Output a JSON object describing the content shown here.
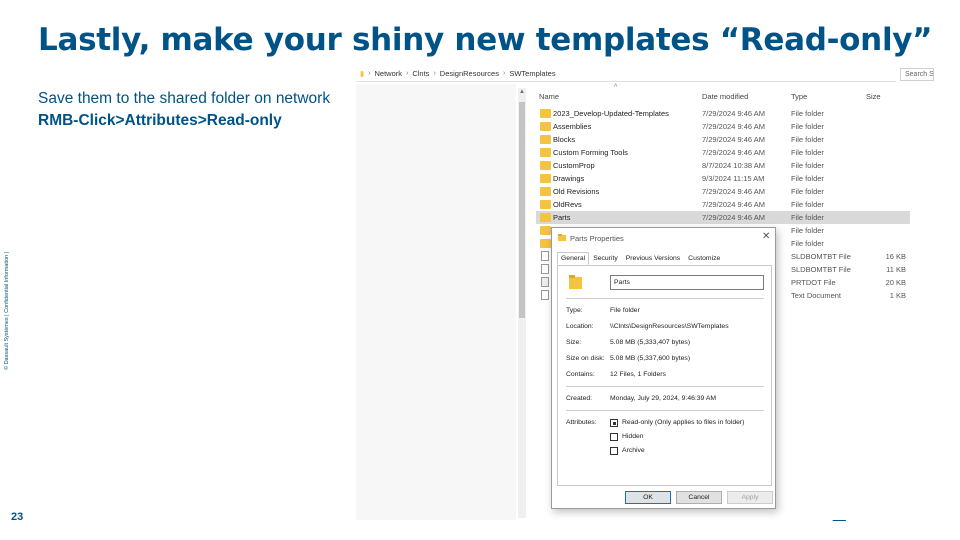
{
  "slide": {
    "title": "Lastly, make your shiny new templates “Read-only”",
    "subtitle": "Save them to the shared folder on network",
    "instruction": "RMB-Click>Attributes>Read-only",
    "sidebar_text": "© Dassault Systèmes | Confidential Information |",
    "page_number": "23",
    "brand_color": "#005386"
  },
  "explorer": {
    "breadcrumb": [
      "Network",
      "Clnts",
      "DesignResources",
      "SWTemplates"
    ],
    "search_placeholder": "Search S",
    "columns": {
      "name": "Name",
      "date": "Date modified",
      "type": "Type",
      "size": "Size"
    },
    "rows": [
      {
        "name": "2023_Develop-Updated-Templates",
        "date": "7/29/2024 9:46 AM",
        "type": "File folder",
        "size": "",
        "icon": "folder-icon"
      },
      {
        "name": "Assemblies",
        "date": "7/29/2024 9:46 AM",
        "type": "File folder",
        "size": "",
        "icon": "folder-icon"
      },
      {
        "name": "Blocks",
        "date": "7/29/2024 9:46 AM",
        "type": "File folder",
        "size": "",
        "icon": "folder-icon"
      },
      {
        "name": "Custom Forming Tools",
        "date": "7/29/2024 9:46 AM",
        "type": "File folder",
        "size": "",
        "icon": "folder-icon"
      },
      {
        "name": "CustomProp",
        "date": "8/7/2024 10:38 AM",
        "type": "File folder",
        "size": "",
        "icon": "folder-icon"
      },
      {
        "name": "Drawings",
        "date": "9/3/2024 11:15 AM",
        "type": "File folder",
        "size": "",
        "icon": "folder-icon"
      },
      {
        "name": "Old Revisions",
        "date": "7/29/2024 9:46 AM",
        "type": "File folder",
        "size": "",
        "icon": "folder-icon"
      },
      {
        "name": "OldRevs",
        "date": "7/29/2024 9:46 AM",
        "type": "File folder",
        "size": "",
        "icon": "folder-icon"
      },
      {
        "name": "Parts",
        "date": "7/29/2024 9:46 AM",
        "type": "File folder",
        "size": "",
        "icon": "folder-icon",
        "selected": true
      },
      {
        "name": "",
        "date": "",
        "type": "File folder",
        "size": "",
        "icon": "folder-icon"
      },
      {
        "name": "",
        "date": "",
        "type": "File folder",
        "size": "",
        "icon": "folder-icon"
      },
      {
        "name": "",
        "date": "",
        "type": "SLDBOMTBT File",
        "size": "16 KB",
        "icon": "file-icon"
      },
      {
        "name": "",
        "date": "",
        "type": "SLDBOMTBT File",
        "size": "11 KB",
        "icon": "file-icon"
      },
      {
        "name": "",
        "date": "",
        "type": "PRTDOT File",
        "size": "20 KB",
        "icon": "file-icon"
      },
      {
        "name": "",
        "date": "",
        "type": "Text Document",
        "size": "1 KB",
        "icon": "file-icon"
      }
    ]
  },
  "dialog": {
    "title": "Parts Properties",
    "tabs": [
      "General",
      "Security",
      "Previous Versions",
      "Customize"
    ],
    "name_value": "Parts",
    "props": [
      {
        "label": "Type:",
        "value": "File folder"
      },
      {
        "label": "Location:",
        "value": "\\\\Clnts\\DesignResources\\SWTemplates"
      },
      {
        "label": "Size:",
        "value": "5.08 MB (5,333,407 bytes)"
      },
      {
        "label": "Size on disk:",
        "value": "5.08 MB (5,337,600 bytes)"
      },
      {
        "label": "Contains:",
        "value": "12 Files, 1 Folders"
      }
    ],
    "created_label": "Created:",
    "created_value": "Monday, July 29, 2024, 9:46:39 AM",
    "attributes_label": "Attributes:",
    "attributes": [
      {
        "label": "Read-only (Only applies to files in folder)",
        "state": "indeterminate"
      },
      {
        "label": "Hidden",
        "state": "unchecked"
      },
      {
        "label": "Archive",
        "state": "unchecked"
      }
    ],
    "buttons": {
      "ok": "OK",
      "cancel": "Cancel",
      "apply": "Apply"
    }
  }
}
